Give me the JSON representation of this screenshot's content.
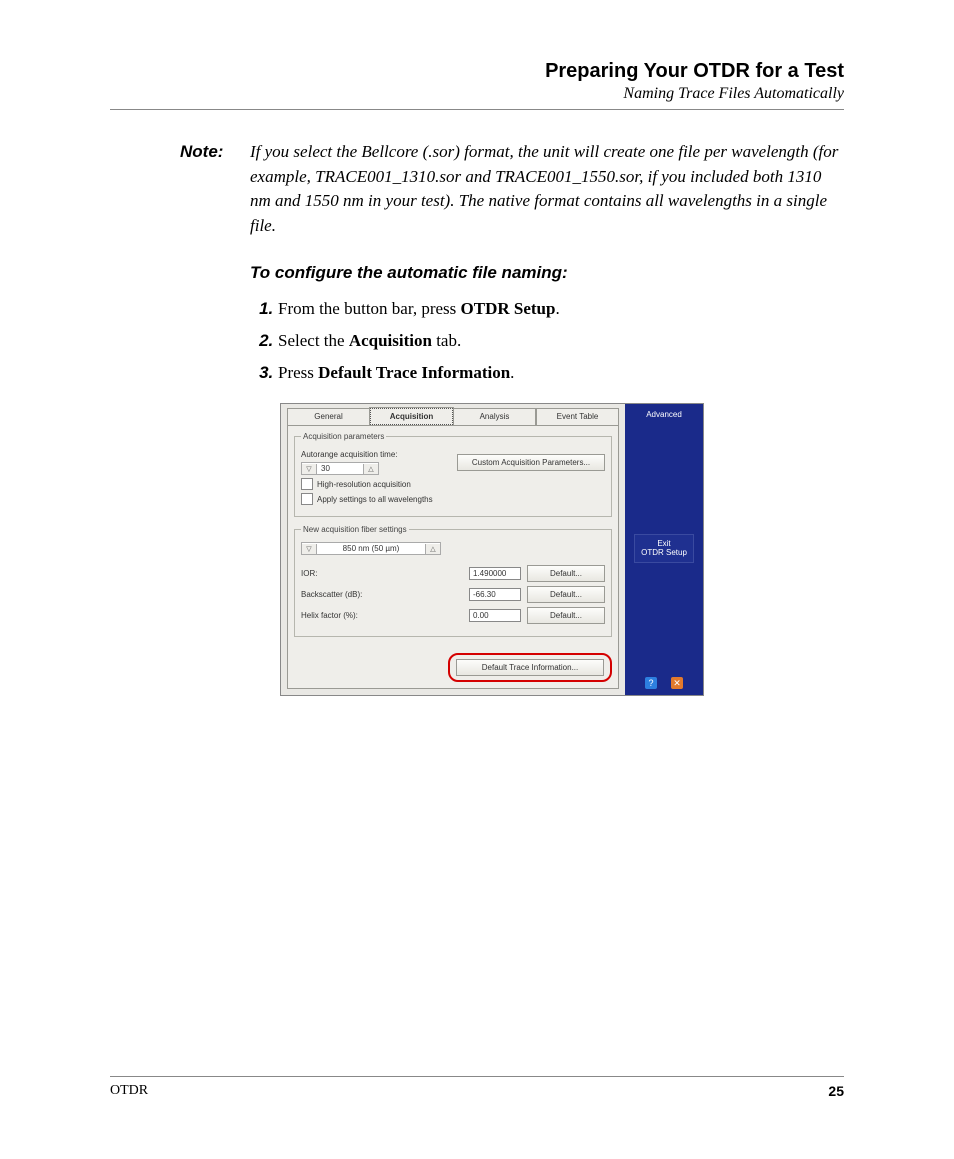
{
  "header": {
    "title": "Preparing Your OTDR for a Test",
    "subtitle": "Naming Trace Files Automatically"
  },
  "note": {
    "label": "Note:",
    "text": "If you select the Bellcore (.sor) format, the unit will create one file per wavelength (for example, TRACE001_1310.sor and TRACE001_1550.sor, if you included both 1310 nm and 1550 nm in your test). The native format contains all wavelengths in a single file."
  },
  "procedure": {
    "heading": "To configure the automatic file naming:",
    "steps": {
      "s1_a": "From the button bar, press ",
      "s1_b": "OTDR Setup",
      "s1_c": ".",
      "s2_a": "Select the ",
      "s2_b": "Acquisition",
      "s2_c": " tab.",
      "s3_a": "Press ",
      "s3_b": "Default Trace Information",
      "s3_c": "."
    }
  },
  "screenshot": {
    "tabs": [
      "General",
      "Acquisition",
      "Analysis",
      "Event Table"
    ],
    "active_tab_index": 1,
    "acq_params": {
      "legend": "Acquisition parameters",
      "autorange_label": "Autorange acquisition time:",
      "autorange_value": "30",
      "custom_btn": "Custom Acquisition Parameters...",
      "chk_highres": "High-resolution acquisition",
      "chk_applyall": "Apply settings to all wavelengths"
    },
    "fiber": {
      "legend": "New acquisition fiber settings",
      "wavelength_value": "850 nm (50 µm)",
      "rows": [
        {
          "label": "IOR:",
          "value": "1.490000",
          "btn": "Default..."
        },
        {
          "label": "Backscatter (dB):",
          "value": "-66.30",
          "btn": "Default..."
        },
        {
          "label": "Helix factor (%):",
          "value": "0.00",
          "btn": "Default..."
        }
      ]
    },
    "bottom_btn": "Default Trace Information...",
    "side": {
      "advanced": "Advanced",
      "exit_line1": "Exit",
      "exit_line2": "OTDR Setup"
    }
  },
  "footer": {
    "left": "OTDR",
    "page": "25"
  }
}
